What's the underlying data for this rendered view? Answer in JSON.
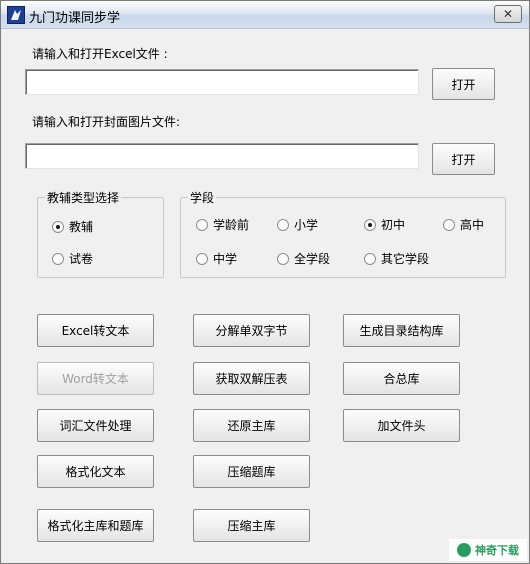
{
  "window": {
    "title": "九门功课同步学",
    "close_glyph": "✕"
  },
  "excel_section": {
    "label": "请输入和打开Excel文件 :",
    "path_value": "",
    "open_button": "打开"
  },
  "cover_section": {
    "label": "请输入和打开封面图片文件:",
    "path_value": "",
    "open_button": "打开"
  },
  "type_group": {
    "title": "教辅类型选择",
    "options": [
      {
        "label": "教辅",
        "checked": true
      },
      {
        "label": "试卷",
        "checked": false
      }
    ]
  },
  "stage_group": {
    "title": "学段",
    "options": [
      {
        "label": "学龄前",
        "checked": false
      },
      {
        "label": "小学",
        "checked": false
      },
      {
        "label": "初中",
        "checked": true
      },
      {
        "label": "高中",
        "checked": false
      },
      {
        "label": "中学",
        "checked": false
      },
      {
        "label": "全学段",
        "checked": false
      },
      {
        "label": "其它学段",
        "checked": false
      }
    ]
  },
  "actions": {
    "excel_to_text": "Excel转文本",
    "split_single_double": "分解单双字节",
    "generate_toc": "生成目录结构库",
    "word_to_text": "Word转文本",
    "get_double_table": "获取双解压表",
    "merge_total": "合总库",
    "vocab_file": "词汇文件处理",
    "restore_main": "还原主库",
    "add_header": "加文件头",
    "format_text": "格式化文本",
    "compress_questions": "压缩题库",
    "format_main_questions": "格式化主库和题库",
    "compress_main": "压缩主库"
  },
  "watermark": {
    "text": "神奇下载"
  },
  "colors": {
    "accent": "#2e9a63",
    "disabled_text": "#a0a0a0"
  }
}
